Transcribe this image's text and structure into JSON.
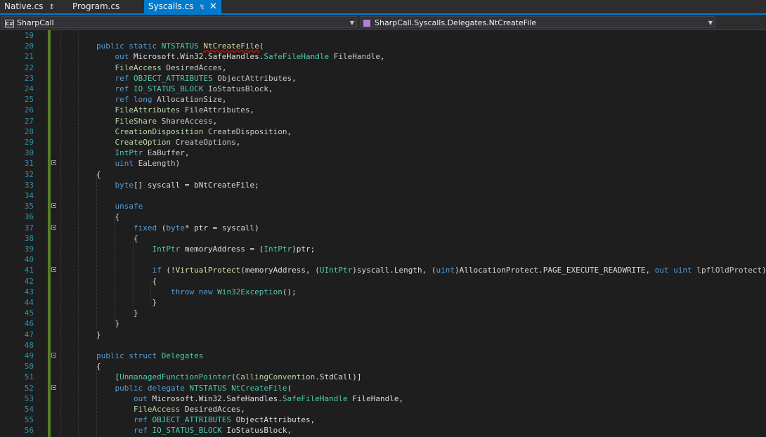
{
  "tabs": [
    {
      "label": "Native.cs",
      "pin": "↕",
      "active": false
    },
    {
      "label": "Program.cs",
      "active": false
    },
    {
      "label": "Syscalls.cs",
      "pin": "↯",
      "close": "✕",
      "active": true
    }
  ],
  "nav": {
    "project_icon": "C#",
    "project": "SharpCall",
    "member": "SharpCall.Syscalls.Delegates.NtCreateFile"
  },
  "editor": {
    "line_numbers": [
      "19",
      "20",
      "21",
      "22",
      "23",
      "24",
      "25",
      "26",
      "27",
      "28",
      "29",
      "30",
      "31",
      "32",
      "33",
      "34",
      "35",
      "36",
      "37",
      "38",
      "39",
      "40",
      "41",
      "42",
      "43",
      "44",
      "45",
      "46",
      "47",
      "48",
      "49",
      "50",
      "51",
      "52",
      "53",
      "54",
      "55",
      "56"
    ]
  },
  "colors": {
    "accent": "#007acc",
    "keyword": "#569cd6",
    "type": "#4ec9b0",
    "method": "#dcdcaa",
    "line_number": "#2b91af",
    "change_bar": "#5a7d2d"
  }
}
